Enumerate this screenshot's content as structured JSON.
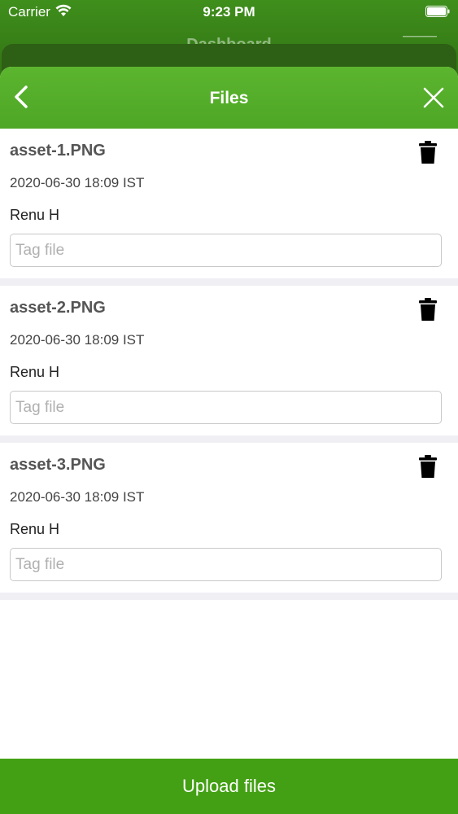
{
  "status_bar": {
    "carrier": "Carrier",
    "time": "9:23 PM"
  },
  "background": {
    "title": "Dashboard"
  },
  "header": {
    "title": "Files"
  },
  "files": [
    {
      "name": "asset-1.PNG",
      "date": "2020-06-30 18:09 IST",
      "user": "Renu H",
      "tag_placeholder": "Tag file"
    },
    {
      "name": "asset-2.PNG",
      "date": "2020-06-30 18:09 IST",
      "user": "Renu H",
      "tag_placeholder": "Tag file"
    },
    {
      "name": "asset-3.PNG",
      "date": "2020-06-30 18:09 IST",
      "user": "Renu H",
      "tag_placeholder": "Tag file"
    }
  ],
  "upload_label": "Upload files",
  "colors": {
    "header_green": "#55ae2a",
    "button_green": "#43a014",
    "separator": "#efeff4"
  },
  "icons": {
    "back": "chevron-left-icon",
    "close": "close-icon",
    "delete": "trash-icon"
  }
}
